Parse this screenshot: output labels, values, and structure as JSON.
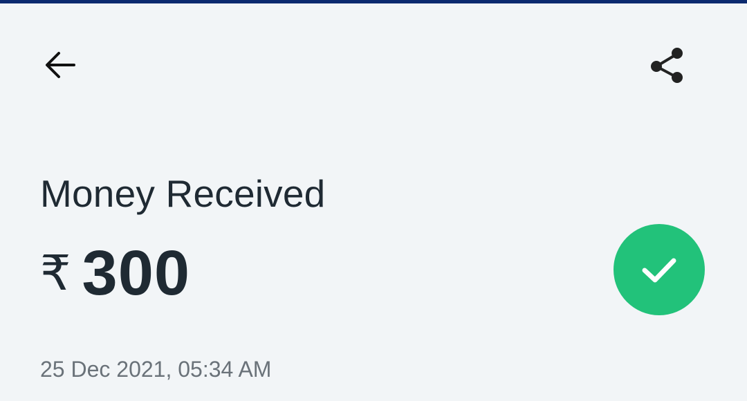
{
  "header": {
    "back_icon": "arrow-left-icon",
    "share_icon": "share-icon"
  },
  "transaction": {
    "title": "Money Received",
    "currency_symbol": "₹",
    "amount": "300",
    "datetime": "25 Dec 2021, 05:34 AM",
    "status_icon": "check-circle-icon",
    "status_color": "#22c27a"
  },
  "colors": {
    "background": "#f2f5f7",
    "top_strip": "#0b2a6f",
    "text_primary": "#1f2a33",
    "text_secondary": "#6a7279"
  }
}
